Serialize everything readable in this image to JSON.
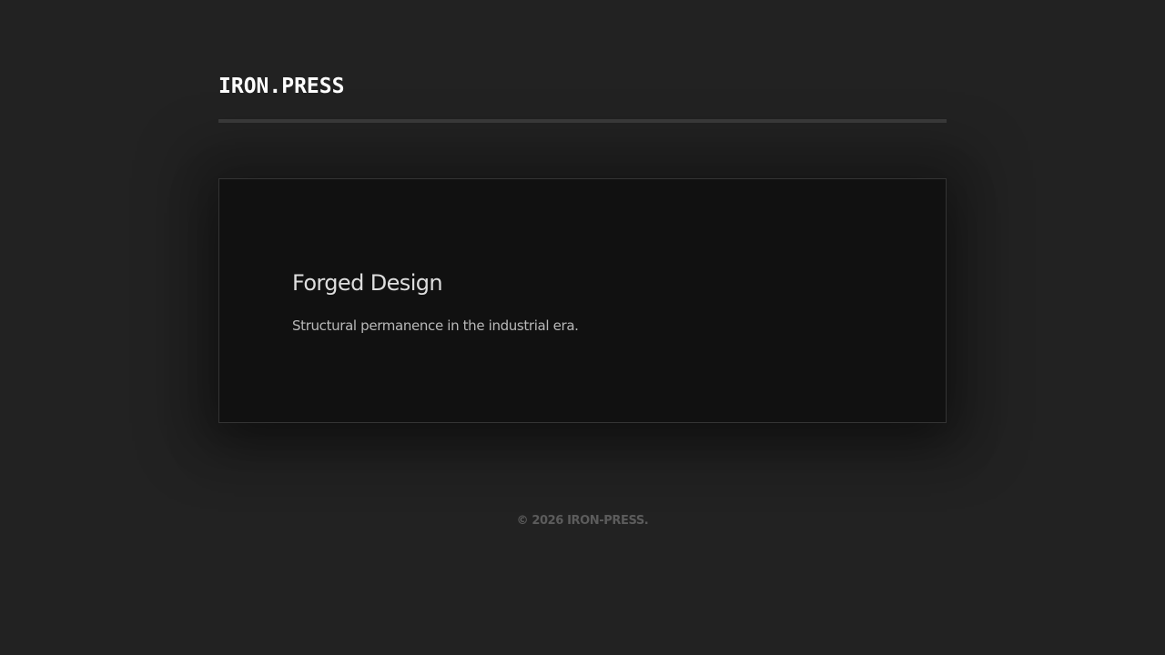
{
  "header": {
    "logo": "IRON.PRESS"
  },
  "hero": {
    "title": "Forged Design",
    "subtitle": "Structural permanence in the industrial era."
  },
  "footer": {
    "copyright": "© 2026 IRON-PRESS."
  },
  "colors": {
    "background": "#222222",
    "card_background": "#111111",
    "logo": "#ffffff",
    "title": "#dedede",
    "subtitle": "#b9b9b9",
    "footer_text": "#5c5c5c",
    "rule": "#3b3b3b"
  }
}
